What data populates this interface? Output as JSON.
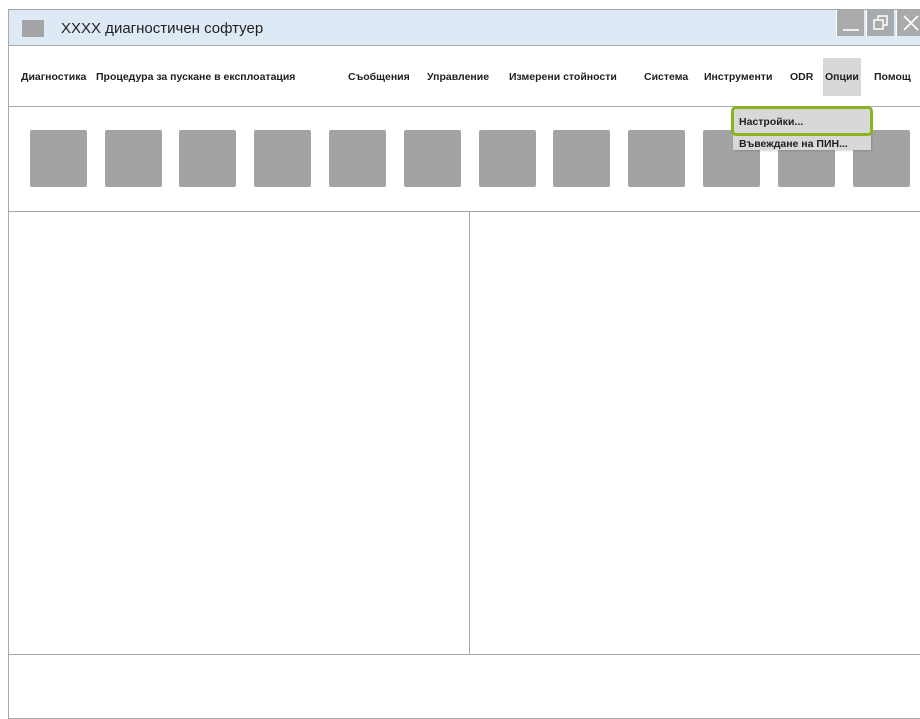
{
  "window": {
    "title": "XXXX диагностичен софтуер",
    "controls": {
      "minimize": "minimize-icon",
      "restore": "restore-icon",
      "close": "close-icon"
    }
  },
  "menubar": {
    "items": [
      {
        "label": "Диагностика"
      },
      {
        "label": "Процедура за пускане в експлоатация"
      },
      {
        "label": "Съобщения"
      },
      {
        "label": "Управление"
      },
      {
        "label": "Измерени стойности"
      },
      {
        "label": "Система"
      },
      {
        "label": "Инструменти"
      },
      {
        "label": "ODR"
      },
      {
        "label": "Опции"
      },
      {
        "label": "Помощ"
      }
    ],
    "active": "Опции"
  },
  "dropdown": {
    "items": [
      {
        "label": "Настройки..."
      },
      {
        "label": "Въвеждане на ПИН..."
      }
    ],
    "highlighted": "Настройки..."
  },
  "toolbar": {
    "button_count": 12
  },
  "colors": {
    "titlebar": "#ddeaf5",
    "placeholder_gray": "#a2a3a5",
    "highlight_green": "#8cb21c",
    "menu_active": "#d6d8da"
  }
}
